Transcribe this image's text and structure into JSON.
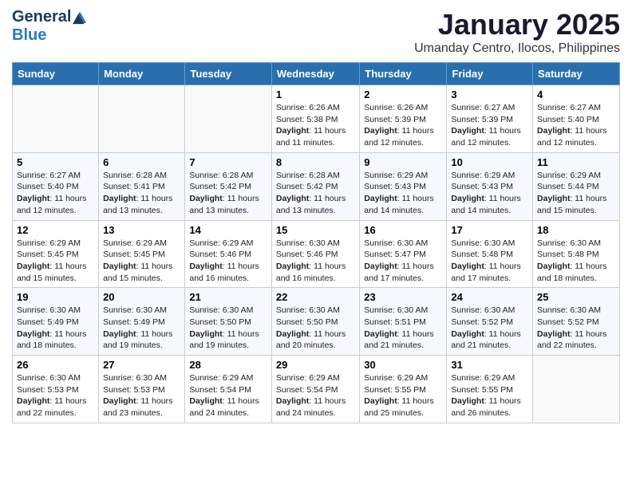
{
  "logo": {
    "general": "General",
    "blue": "Blue"
  },
  "header": {
    "title": "January 2025",
    "subtitle": "Umanday Centro, Ilocos, Philippines"
  },
  "days_of_week": [
    "Sunday",
    "Monday",
    "Tuesday",
    "Wednesday",
    "Thursday",
    "Friday",
    "Saturday"
  ],
  "weeks": [
    [
      {
        "day": "",
        "info": ""
      },
      {
        "day": "",
        "info": ""
      },
      {
        "day": "",
        "info": ""
      },
      {
        "day": "1",
        "info": "Sunrise: 6:26 AM\nSunset: 5:38 PM\nDaylight: 11 hours and 11 minutes."
      },
      {
        "day": "2",
        "info": "Sunrise: 6:26 AM\nSunset: 5:39 PM\nDaylight: 11 hours and 12 minutes."
      },
      {
        "day": "3",
        "info": "Sunrise: 6:27 AM\nSunset: 5:39 PM\nDaylight: 11 hours and 12 minutes."
      },
      {
        "day": "4",
        "info": "Sunrise: 6:27 AM\nSunset: 5:40 PM\nDaylight: 11 hours and 12 minutes."
      }
    ],
    [
      {
        "day": "5",
        "info": "Sunrise: 6:27 AM\nSunset: 5:40 PM\nDaylight: 11 hours and 12 minutes."
      },
      {
        "day": "6",
        "info": "Sunrise: 6:28 AM\nSunset: 5:41 PM\nDaylight: 11 hours and 13 minutes."
      },
      {
        "day": "7",
        "info": "Sunrise: 6:28 AM\nSunset: 5:42 PM\nDaylight: 11 hours and 13 minutes."
      },
      {
        "day": "8",
        "info": "Sunrise: 6:28 AM\nSunset: 5:42 PM\nDaylight: 11 hours and 13 minutes."
      },
      {
        "day": "9",
        "info": "Sunrise: 6:29 AM\nSunset: 5:43 PM\nDaylight: 11 hours and 14 minutes."
      },
      {
        "day": "10",
        "info": "Sunrise: 6:29 AM\nSunset: 5:43 PM\nDaylight: 11 hours and 14 minutes."
      },
      {
        "day": "11",
        "info": "Sunrise: 6:29 AM\nSunset: 5:44 PM\nDaylight: 11 hours and 15 minutes."
      }
    ],
    [
      {
        "day": "12",
        "info": "Sunrise: 6:29 AM\nSunset: 5:45 PM\nDaylight: 11 hours and 15 minutes."
      },
      {
        "day": "13",
        "info": "Sunrise: 6:29 AM\nSunset: 5:45 PM\nDaylight: 11 hours and 15 minutes."
      },
      {
        "day": "14",
        "info": "Sunrise: 6:29 AM\nSunset: 5:46 PM\nDaylight: 11 hours and 16 minutes."
      },
      {
        "day": "15",
        "info": "Sunrise: 6:30 AM\nSunset: 5:46 PM\nDaylight: 11 hours and 16 minutes."
      },
      {
        "day": "16",
        "info": "Sunrise: 6:30 AM\nSunset: 5:47 PM\nDaylight: 11 hours and 17 minutes."
      },
      {
        "day": "17",
        "info": "Sunrise: 6:30 AM\nSunset: 5:48 PM\nDaylight: 11 hours and 17 minutes."
      },
      {
        "day": "18",
        "info": "Sunrise: 6:30 AM\nSunset: 5:48 PM\nDaylight: 11 hours and 18 minutes."
      }
    ],
    [
      {
        "day": "19",
        "info": "Sunrise: 6:30 AM\nSunset: 5:49 PM\nDaylight: 11 hours and 18 minutes."
      },
      {
        "day": "20",
        "info": "Sunrise: 6:30 AM\nSunset: 5:49 PM\nDaylight: 11 hours and 19 minutes."
      },
      {
        "day": "21",
        "info": "Sunrise: 6:30 AM\nSunset: 5:50 PM\nDaylight: 11 hours and 19 minutes."
      },
      {
        "day": "22",
        "info": "Sunrise: 6:30 AM\nSunset: 5:50 PM\nDaylight: 11 hours and 20 minutes."
      },
      {
        "day": "23",
        "info": "Sunrise: 6:30 AM\nSunset: 5:51 PM\nDaylight: 11 hours and 21 minutes."
      },
      {
        "day": "24",
        "info": "Sunrise: 6:30 AM\nSunset: 5:52 PM\nDaylight: 11 hours and 21 minutes."
      },
      {
        "day": "25",
        "info": "Sunrise: 6:30 AM\nSunset: 5:52 PM\nDaylight: 11 hours and 22 minutes."
      }
    ],
    [
      {
        "day": "26",
        "info": "Sunrise: 6:30 AM\nSunset: 5:53 PM\nDaylight: 11 hours and 22 minutes."
      },
      {
        "day": "27",
        "info": "Sunrise: 6:30 AM\nSunset: 5:53 PM\nDaylight: 11 hours and 23 minutes."
      },
      {
        "day": "28",
        "info": "Sunrise: 6:29 AM\nSunset: 5:54 PM\nDaylight: 11 hours and 24 minutes."
      },
      {
        "day": "29",
        "info": "Sunrise: 6:29 AM\nSunset: 5:54 PM\nDaylight: 11 hours and 24 minutes."
      },
      {
        "day": "30",
        "info": "Sunrise: 6:29 AM\nSunset: 5:55 PM\nDaylight: 11 hours and 25 minutes."
      },
      {
        "day": "31",
        "info": "Sunrise: 6:29 AM\nSunset: 5:55 PM\nDaylight: 11 hours and 26 minutes."
      },
      {
        "day": "",
        "info": ""
      }
    ]
  ]
}
